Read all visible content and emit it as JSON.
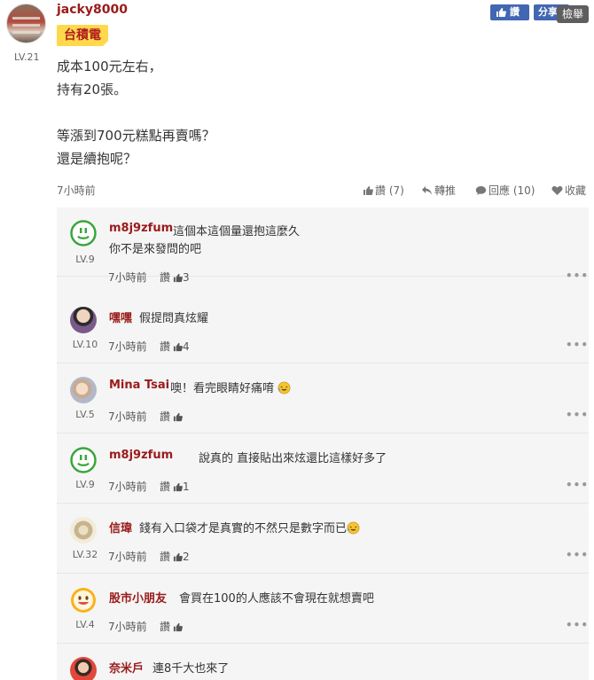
{
  "post": {
    "author": "jacky8000",
    "level": "LV.21",
    "stock_tag": "台積電",
    "like_button": "讚",
    "share_button": "分享",
    "report_button": "檢舉",
    "body_lines": [
      "成本100元左右，",
      "持有20張。",
      "",
      "等漲到700元糕點再賣嗎？",
      "還是續抱呢？"
    ],
    "time": "7小時前",
    "actions": {
      "like": "讚 (7)",
      "forward": "轉推",
      "reply": "回應 (10)",
      "bookmark": "收藏"
    }
  },
  "comments": [
    {
      "author": "m8j9zfum",
      "level": "LV.9",
      "text": "這個本這個量還抱這麼久",
      "text2": "你不是來發問的吧",
      "time": "7小時前",
      "like_label": "讚",
      "like_count": "3",
      "avatar": "smile-icon",
      "emoji": false
    },
    {
      "author": "嘿嘿",
      "level": "LV.10",
      "text": "假提問真炫耀",
      "text2": "",
      "time": "7小時前",
      "like_label": "讚",
      "like_count": "4",
      "avatar": "photo",
      "emoji": false
    },
    {
      "author": "Mina Tsai",
      "level": "LV.5",
      "text": "噢！看完眼睛好痛唷",
      "text2": "",
      "time": "7小時前",
      "like_label": "讚",
      "like_count": "",
      "avatar": "photo",
      "emoji": true
    },
    {
      "author": "m8j9zfum",
      "level": "LV.9",
      "text": "說真的 直接貼出來炫還比這樣好多了",
      "text2": "",
      "time": "7小時前",
      "like_label": "讚",
      "like_count": "1",
      "avatar": "smile-icon",
      "emoji": false
    },
    {
      "author": "信瑋",
      "level": "LV.32",
      "text": "錢有入口袋才是真實的不然只是數字而已",
      "text2": "",
      "time": "7小時前",
      "like_label": "讚",
      "like_count": "2",
      "avatar": "photo",
      "emoji": true
    },
    {
      "author": "股市小朋友",
      "level": "LV.4",
      "text": "會買在100的人應該不會現在就想賣吧",
      "text2": "",
      "time": "7小時前",
      "like_label": "讚",
      "like_count": "",
      "avatar": "yellow-smile-icon",
      "emoji": false
    },
    {
      "author": "奈米戶",
      "level": "",
      "text": "連8千大也來了",
      "text2": "",
      "time": "",
      "like_label": "",
      "like_count": "",
      "avatar": "photo",
      "emoji": false
    }
  ],
  "more_icon": "•••",
  "colors": {
    "author": "#9a1b1b",
    "tag_bg": "#ffd84d",
    "facebook": "#4267b2"
  }
}
